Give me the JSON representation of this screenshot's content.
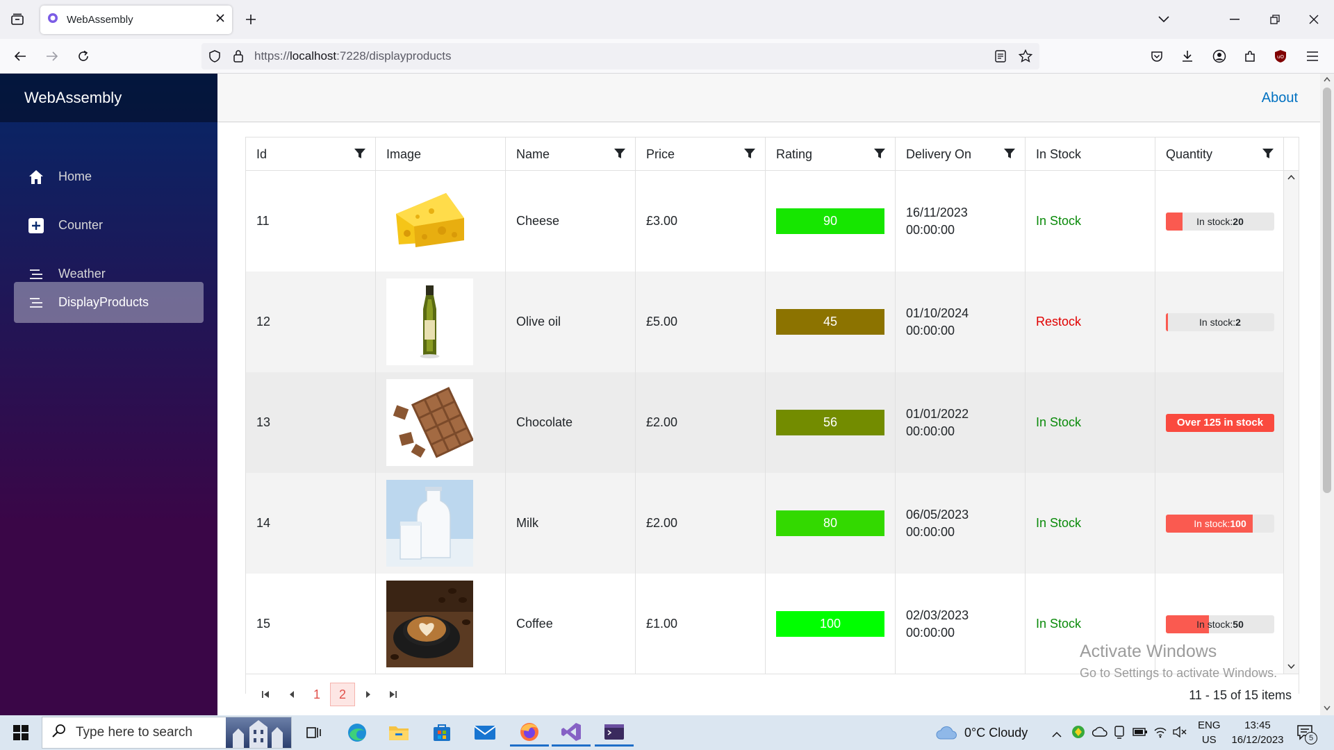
{
  "browser": {
    "tab_title": "WebAssembly",
    "url_prefix": "https://",
    "url_host": "localhost",
    "url_rest": ":7228/displayproducts"
  },
  "app": {
    "brand": "WebAssembly",
    "about": "About",
    "nav": [
      {
        "label": "Home",
        "icon": "home-icon"
      },
      {
        "label": "Counter",
        "icon": "plus-icon"
      },
      {
        "label": "Weather",
        "icon": "list-icon"
      },
      {
        "label": "DisplayProducts",
        "icon": "list-icon"
      }
    ]
  },
  "grid": {
    "columns": [
      "Id",
      "Image",
      "Name",
      "Price",
      "Rating",
      "Delivery On",
      "In Stock",
      "Quantity"
    ],
    "rows": [
      {
        "id": "11",
        "image": "cheese",
        "name": "Cheese",
        "price": "£3.00",
        "rating": "90",
        "rating_color": "#16e600",
        "date": "16/11/2023",
        "time": "00:00:00",
        "stock": "In Stock",
        "qty_prefix": "In stock:",
        "qty_value": "20",
        "qty_level": 0.13
      },
      {
        "id": "12",
        "image": "olive-oil",
        "name": "Olive oil",
        "price": "£5.00",
        "rating": "45",
        "rating_color": "#8c7300",
        "date": "01/10/2024",
        "time": "00:00:00",
        "stock": "Restock",
        "qty_prefix": "In stock:",
        "qty_value": "2",
        "qty_level": 0.015
      },
      {
        "id": "13",
        "image": "chocolate",
        "name": "Chocolate",
        "price": "£2.00",
        "rating": "56",
        "rating_color": "#738c00",
        "date": "01/01/2022",
        "time": "00:00:00",
        "stock": "In Stock",
        "qty_over": "Over 125 in stock"
      },
      {
        "id": "14",
        "image": "milk",
        "name": "Milk",
        "price": "£2.00",
        "rating": "80",
        "rating_color": "#33d900",
        "date": "06/05/2023",
        "time": "00:00:00",
        "stock": "In Stock",
        "qty_prefix": "In stock:",
        "qty_value": "100",
        "qty_level": 0.8
      },
      {
        "id": "15",
        "image": "coffee",
        "name": "Coffee",
        "price": "£1.00",
        "rating": "100",
        "rating_color": "#00ff00",
        "date": "02/03/2023",
        "time": "00:00:00",
        "stock": "In Stock",
        "qty_prefix": "In stock:",
        "qty_value": "50",
        "qty_level": 0.4
      }
    ],
    "pager": {
      "pages": [
        "1",
        "2"
      ],
      "current": "2",
      "info": "11 - 15 of 15 items"
    }
  },
  "watermark": {
    "line1": "Activate Windows",
    "line2": "Go to Settings to activate Windows."
  },
  "taskbar": {
    "search_placeholder": "Type here to search",
    "weather": "0°C  Cloudy",
    "lang1": "ENG",
    "lang2": "US",
    "time": "13:45",
    "date": "16/12/2023",
    "notifications": "5"
  }
}
